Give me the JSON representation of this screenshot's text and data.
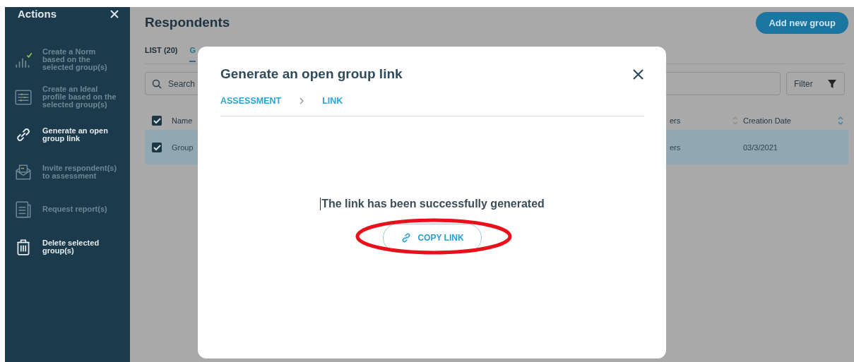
{
  "sidebar": {
    "title": "Actions",
    "items": [
      {
        "label": "Create a Norm\nbased on the\nselected group(s)",
        "kind": "chart",
        "disabled": true
      },
      {
        "label": "Create an Ideal\nprofile based on the\nselected group(s)",
        "kind": "profile",
        "disabled": true
      },
      {
        "label": "Generate an open\ngroup link",
        "kind": "link",
        "disabled": false
      },
      {
        "label": "Invite respondent(s)\nto assessment",
        "kind": "envelope",
        "disabled": true
      },
      {
        "label": "Request report(s)",
        "kind": "report",
        "disabled": true
      },
      {
        "label": "Delete selected\ngroup(s)",
        "kind": "trash",
        "disabled": false
      }
    ]
  },
  "page": {
    "title": "Respondents",
    "add_button": "Add new group",
    "tabs": [
      {
        "label": "LIST (20)",
        "selected": false
      },
      {
        "label": "G",
        "selected": true
      }
    ],
    "search": {
      "placeholder": "Search"
    },
    "filter": "Filter",
    "table": {
      "header_checked": true,
      "columns": [
        {
          "label": "Name"
        },
        {
          "label": "ers",
          "sort_active": false
        },
        {
          "label": "Creation Date",
          "sort_active": true
        }
      ],
      "rows": [
        {
          "selected": true,
          "checked": true,
          "cells": [
            "Group",
            "ers",
            "03/3/2021"
          ]
        }
      ]
    }
  },
  "modal": {
    "title": "Generate an open group link",
    "steps": [
      {
        "label": "ASSESSMENT"
      },
      {
        "label": "LINK"
      }
    ],
    "message": "The link has been successfully generated",
    "copy_button": "COPY LINK",
    "highlighted": true
  }
}
